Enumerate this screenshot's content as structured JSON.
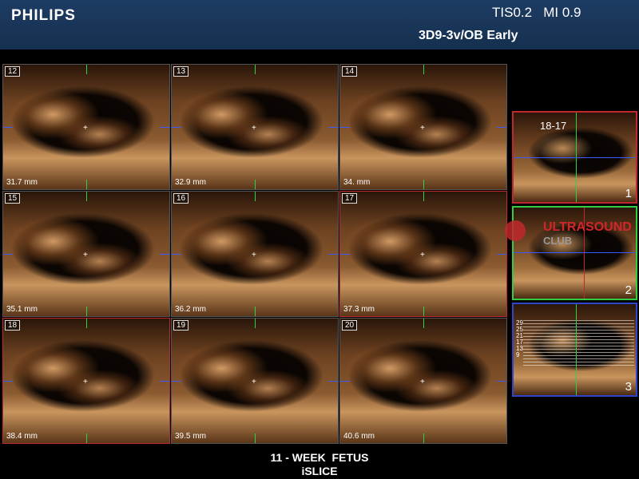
{
  "header": {
    "brand": "PHILIPS",
    "tis_mi": "TIS0.2   MI 0.9",
    "probe_preset": "3D9-3v/OB Early"
  },
  "tiles": [
    {
      "num": "12",
      "depth": "31.7 mm"
    },
    {
      "num": "13",
      "depth": "32.9 mm"
    },
    {
      "num": "14",
      "depth": "34. mm"
    },
    {
      "num": "15",
      "depth": "35.1 mm"
    },
    {
      "num": "16",
      "depth": "36.2 mm"
    },
    {
      "num": "17",
      "depth": "37.3 mm"
    },
    {
      "num": "18",
      "depth": "38.4 mm"
    },
    {
      "num": "19",
      "depth": "39.5 mm"
    },
    {
      "num": "20",
      "depth": "40.6 mm"
    }
  ],
  "side_panels": {
    "panel1": {
      "label": "1",
      "tag": "18-17"
    },
    "panel2": {
      "label": "2"
    },
    "panel3": {
      "label": "3",
      "ticks": "29\n25\n21\n17\n13\n9"
    }
  },
  "watermark": {
    "line1": "ULTRASOUND",
    "line2": "CLUB"
  },
  "caption": {
    "line1": "11 - WEEK  FETUS",
    "line2": "iSLICE"
  },
  "colors": {
    "header_bg": "#1d3c63",
    "accent_red": "#c0282d",
    "accent_green": "#33cc44",
    "accent_blue": "#3344cc"
  }
}
